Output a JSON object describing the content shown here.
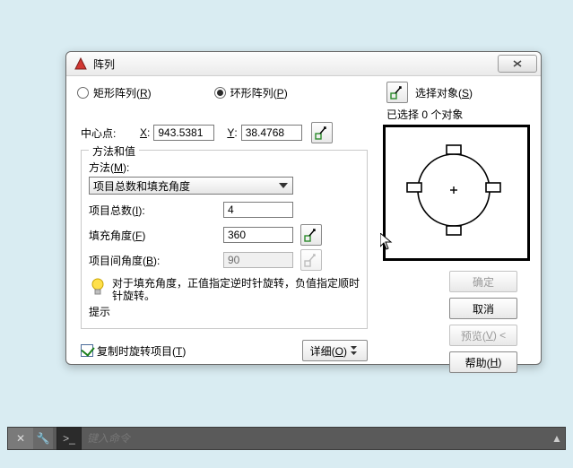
{
  "dialog": {
    "title": "阵列",
    "rect_option": "矩形阵列(R)",
    "polar_option": "环形阵列(P)",
    "selected_option": "polar",
    "select_objects_btn": "选择对象(S)",
    "selected_count_text": "已选择 0 个对象",
    "center": {
      "label": "中心点:",
      "x_label": "X:",
      "x_value": "943.5381",
      "y_label": "Y:",
      "y_value": "38.4768"
    },
    "group": {
      "title": "方法和值",
      "method_label": "方法(M):",
      "method_value": "项目总数和填充角度",
      "items_label": "项目总数(I):",
      "items_value": "4",
      "fill_angle_label": "填充角度(F)",
      "fill_angle_value": "360",
      "item_angle_label": "项目间角度(B):",
      "item_angle_value": "90"
    },
    "tip": {
      "label": "提示",
      "text": "对于填充角度，正值指定逆时针旋转，负值指定顺时针旋转。"
    },
    "copy_rotate_checkbox": "复制时旋转项目(T)",
    "copy_rotate_checked": true,
    "details_btn": "详细(O)",
    "buttons": {
      "ok": "确定",
      "cancel": "取消",
      "preview": "预览(V) <",
      "help": "帮助(H)"
    }
  },
  "cmdbar": {
    "x_label": "✕",
    "wrench": "🔧",
    "prompt": ">_",
    "placeholder": "键入命令",
    "tri": "▲"
  }
}
